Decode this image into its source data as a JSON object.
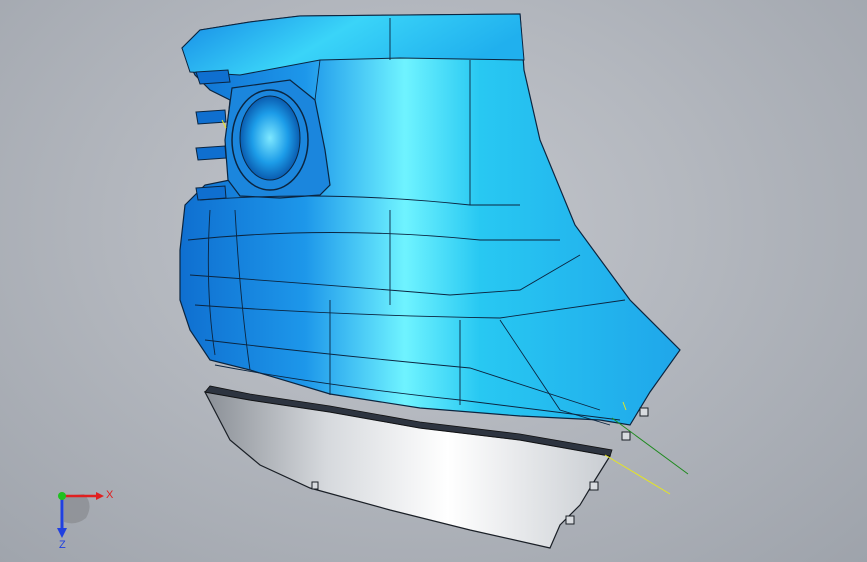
{
  "viewport": {
    "background": "#b3b7be",
    "part_color": "#1a8fe6",
    "part_highlight": "#6cf2ff",
    "lower_panel_color": "#eef0f2",
    "edge_color": "#0b2540"
  },
  "triad": {
    "x_label": "X",
    "z_label": "Z",
    "x_color": "#e02020",
    "y_color": "#20c020",
    "z_color": "#2040e0"
  }
}
